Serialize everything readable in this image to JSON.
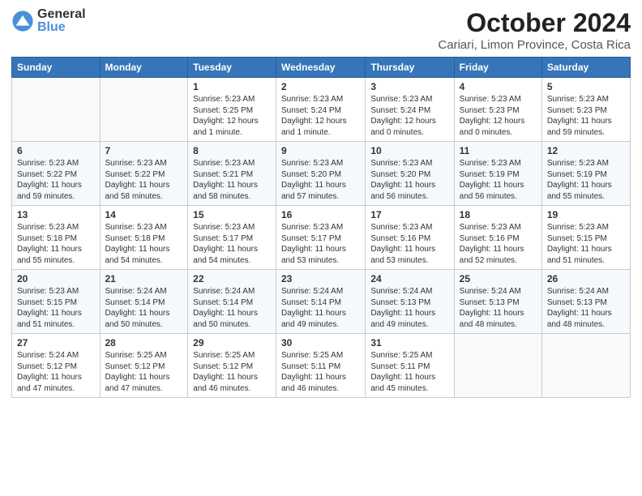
{
  "header": {
    "logo_general": "General",
    "logo_blue": "Blue",
    "title": "October 2024",
    "location": "Cariari, Limon Province, Costa Rica"
  },
  "days_of_week": [
    "Sunday",
    "Monday",
    "Tuesday",
    "Wednesday",
    "Thursday",
    "Friday",
    "Saturday"
  ],
  "weeks": [
    [
      {
        "num": "",
        "info": ""
      },
      {
        "num": "",
        "info": ""
      },
      {
        "num": "1",
        "info": "Sunrise: 5:23 AM\nSunset: 5:25 PM\nDaylight: 12 hours\nand 1 minute."
      },
      {
        "num": "2",
        "info": "Sunrise: 5:23 AM\nSunset: 5:24 PM\nDaylight: 12 hours\nand 1 minute."
      },
      {
        "num": "3",
        "info": "Sunrise: 5:23 AM\nSunset: 5:24 PM\nDaylight: 12 hours\nand 0 minutes."
      },
      {
        "num": "4",
        "info": "Sunrise: 5:23 AM\nSunset: 5:23 PM\nDaylight: 12 hours\nand 0 minutes."
      },
      {
        "num": "5",
        "info": "Sunrise: 5:23 AM\nSunset: 5:23 PM\nDaylight: 11 hours\nand 59 minutes."
      }
    ],
    [
      {
        "num": "6",
        "info": "Sunrise: 5:23 AM\nSunset: 5:22 PM\nDaylight: 11 hours\nand 59 minutes."
      },
      {
        "num": "7",
        "info": "Sunrise: 5:23 AM\nSunset: 5:22 PM\nDaylight: 11 hours\nand 58 minutes."
      },
      {
        "num": "8",
        "info": "Sunrise: 5:23 AM\nSunset: 5:21 PM\nDaylight: 11 hours\nand 58 minutes."
      },
      {
        "num": "9",
        "info": "Sunrise: 5:23 AM\nSunset: 5:20 PM\nDaylight: 11 hours\nand 57 minutes."
      },
      {
        "num": "10",
        "info": "Sunrise: 5:23 AM\nSunset: 5:20 PM\nDaylight: 11 hours\nand 56 minutes."
      },
      {
        "num": "11",
        "info": "Sunrise: 5:23 AM\nSunset: 5:19 PM\nDaylight: 11 hours\nand 56 minutes."
      },
      {
        "num": "12",
        "info": "Sunrise: 5:23 AM\nSunset: 5:19 PM\nDaylight: 11 hours\nand 55 minutes."
      }
    ],
    [
      {
        "num": "13",
        "info": "Sunrise: 5:23 AM\nSunset: 5:18 PM\nDaylight: 11 hours\nand 55 minutes."
      },
      {
        "num": "14",
        "info": "Sunrise: 5:23 AM\nSunset: 5:18 PM\nDaylight: 11 hours\nand 54 minutes."
      },
      {
        "num": "15",
        "info": "Sunrise: 5:23 AM\nSunset: 5:17 PM\nDaylight: 11 hours\nand 54 minutes."
      },
      {
        "num": "16",
        "info": "Sunrise: 5:23 AM\nSunset: 5:17 PM\nDaylight: 11 hours\nand 53 minutes."
      },
      {
        "num": "17",
        "info": "Sunrise: 5:23 AM\nSunset: 5:16 PM\nDaylight: 11 hours\nand 53 minutes."
      },
      {
        "num": "18",
        "info": "Sunrise: 5:23 AM\nSunset: 5:16 PM\nDaylight: 11 hours\nand 52 minutes."
      },
      {
        "num": "19",
        "info": "Sunrise: 5:23 AM\nSunset: 5:15 PM\nDaylight: 11 hours\nand 51 minutes."
      }
    ],
    [
      {
        "num": "20",
        "info": "Sunrise: 5:23 AM\nSunset: 5:15 PM\nDaylight: 11 hours\nand 51 minutes."
      },
      {
        "num": "21",
        "info": "Sunrise: 5:24 AM\nSunset: 5:14 PM\nDaylight: 11 hours\nand 50 minutes."
      },
      {
        "num": "22",
        "info": "Sunrise: 5:24 AM\nSunset: 5:14 PM\nDaylight: 11 hours\nand 50 minutes."
      },
      {
        "num": "23",
        "info": "Sunrise: 5:24 AM\nSunset: 5:14 PM\nDaylight: 11 hours\nand 49 minutes."
      },
      {
        "num": "24",
        "info": "Sunrise: 5:24 AM\nSunset: 5:13 PM\nDaylight: 11 hours\nand 49 minutes."
      },
      {
        "num": "25",
        "info": "Sunrise: 5:24 AM\nSunset: 5:13 PM\nDaylight: 11 hours\nand 48 minutes."
      },
      {
        "num": "26",
        "info": "Sunrise: 5:24 AM\nSunset: 5:13 PM\nDaylight: 11 hours\nand 48 minutes."
      }
    ],
    [
      {
        "num": "27",
        "info": "Sunrise: 5:24 AM\nSunset: 5:12 PM\nDaylight: 11 hours\nand 47 minutes."
      },
      {
        "num": "28",
        "info": "Sunrise: 5:25 AM\nSunset: 5:12 PM\nDaylight: 11 hours\nand 47 minutes."
      },
      {
        "num": "29",
        "info": "Sunrise: 5:25 AM\nSunset: 5:12 PM\nDaylight: 11 hours\nand 46 minutes."
      },
      {
        "num": "30",
        "info": "Sunrise: 5:25 AM\nSunset: 5:11 PM\nDaylight: 11 hours\nand 46 minutes."
      },
      {
        "num": "31",
        "info": "Sunrise: 5:25 AM\nSunset: 5:11 PM\nDaylight: 11 hours\nand 45 minutes."
      },
      {
        "num": "",
        "info": ""
      },
      {
        "num": "",
        "info": ""
      }
    ]
  ]
}
